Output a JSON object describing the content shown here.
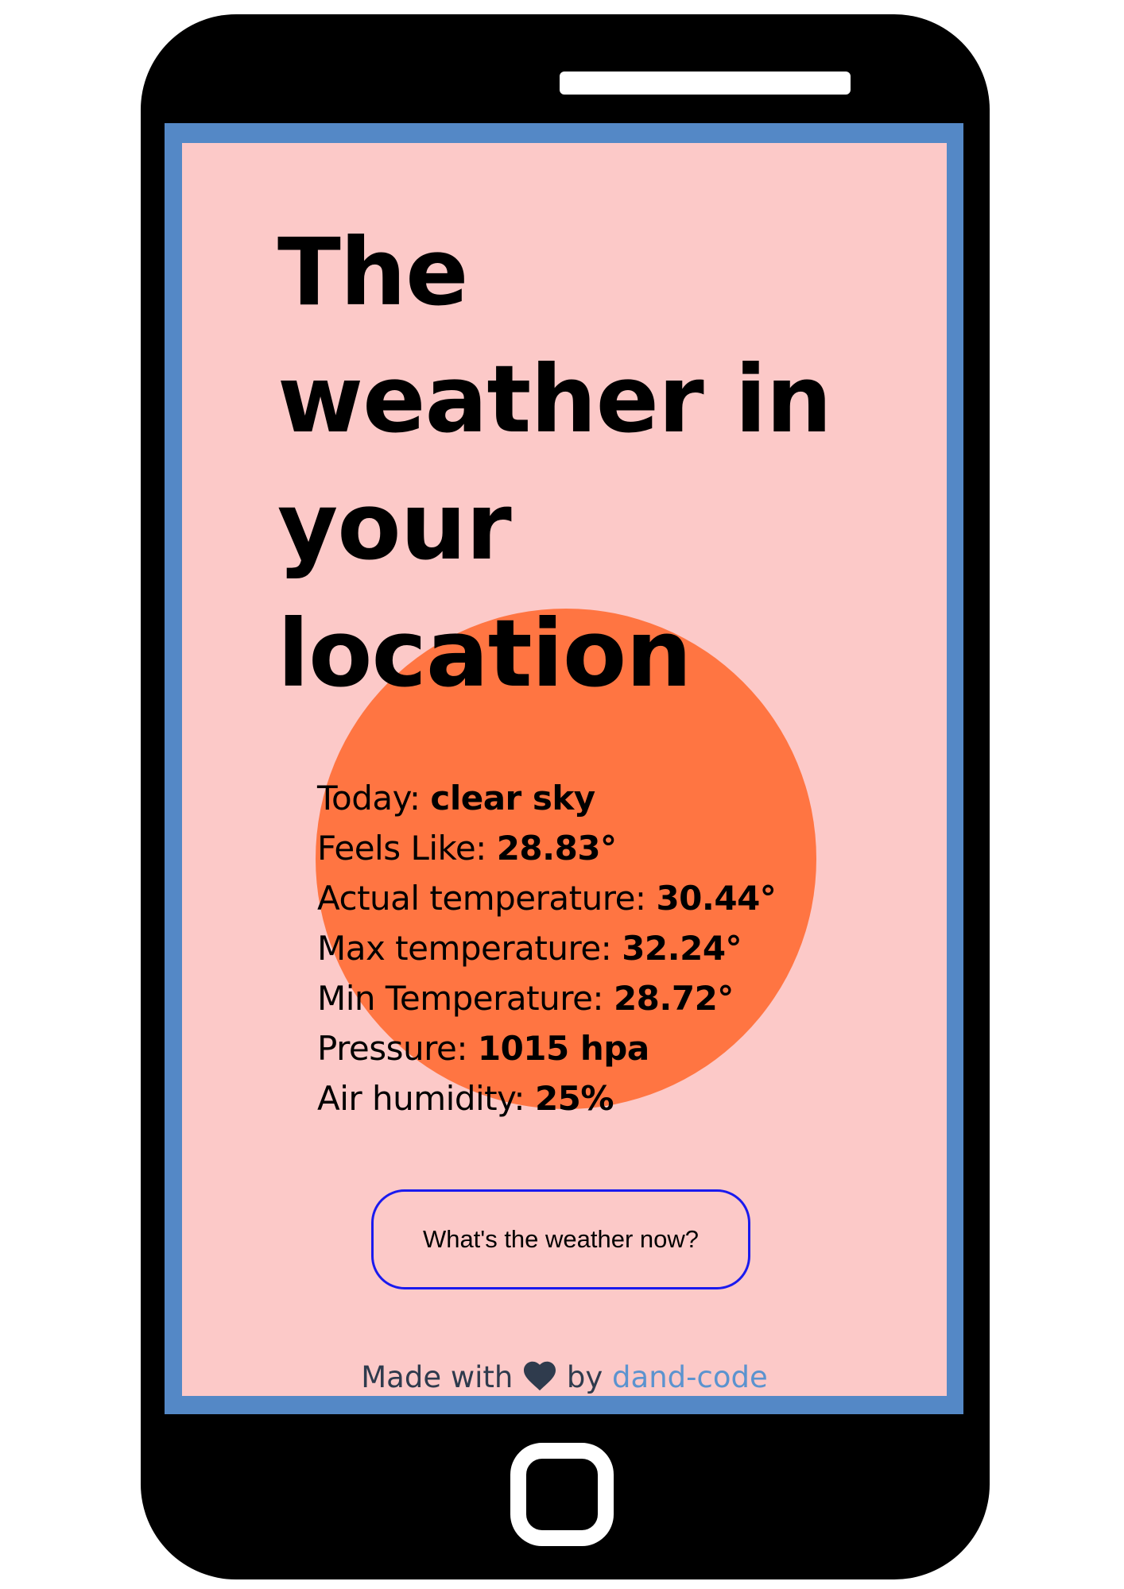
{
  "title": {
    "line1": "The",
    "line2": "weather in",
    "line3": "your",
    "line4": "location"
  },
  "weather": {
    "today_label": "Today:",
    "today_value": "clear sky",
    "feels_like_label": "Feels Like:",
    "feels_like_value": "28.83°",
    "actual_label": "Actual temperature:",
    "actual_value": "30.44°",
    "max_label": "Max temperature:",
    "max_value": "32.24°",
    "min_label": "Min Temperature:",
    "min_value": "28.72°",
    "pressure_label": "Pressure:",
    "pressure_value": "1015 hpa",
    "humidity_label": "Air humidity:",
    "humidity_value": "25%"
  },
  "button": {
    "label": "What's the weather now?"
  },
  "footer": {
    "made_with": "Made with",
    "by": "by",
    "author": "dand-code"
  },
  "icons": {
    "heart": "heart-icon"
  },
  "colors": {
    "screen_background": "#fcc9c8",
    "sun": "#ff7542",
    "screen_frame": "#5488c6",
    "button_border": "#1a1aef",
    "link": "#5b93cf",
    "footer_text": "#2f3b4d"
  }
}
